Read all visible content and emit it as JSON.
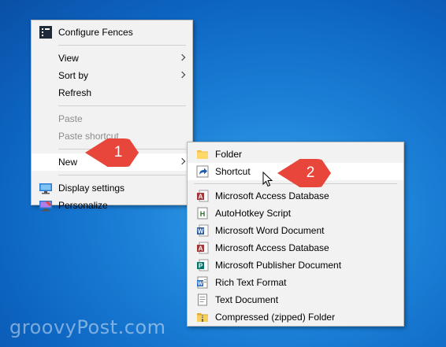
{
  "context_menu": {
    "items": [
      {
        "label": "Configure Fences",
        "icon": "fences-icon",
        "submenu": false,
        "enabled": true
      },
      {
        "label": "View",
        "submenu": true,
        "enabled": true
      },
      {
        "label": "Sort by",
        "submenu": true,
        "enabled": true
      },
      {
        "label": "Refresh",
        "submenu": false,
        "enabled": true
      },
      {
        "label": "Paste",
        "submenu": false,
        "enabled": false
      },
      {
        "label": "Paste shortcut",
        "submenu": false,
        "enabled": false
      },
      {
        "label": "New",
        "submenu": true,
        "enabled": true,
        "highlighted": true
      },
      {
        "label": "Display settings",
        "icon": "display-settings-icon",
        "enabled": true
      },
      {
        "label": "Personalize",
        "icon": "personalize-icon",
        "enabled": true
      }
    ]
  },
  "new_submenu": {
    "items": [
      {
        "label": "Folder",
        "icon": "folder-icon"
      },
      {
        "label": "Shortcut",
        "icon": "shortcut-icon",
        "highlighted": true
      },
      {
        "label": "Microsoft Access Database",
        "icon": "access-icon"
      },
      {
        "label": "AutoHotkey Script",
        "icon": "autohotkey-icon"
      },
      {
        "label": "Microsoft Word Document",
        "icon": "word-icon"
      },
      {
        "label": "Microsoft Access Database",
        "icon": "access-icon"
      },
      {
        "label": "Microsoft Publisher Document",
        "icon": "publisher-icon"
      },
      {
        "label": "Rich Text Format",
        "icon": "wordpad-icon"
      },
      {
        "label": "Text Document",
        "icon": "text-document-icon"
      },
      {
        "label": "Compressed (zipped) Folder",
        "icon": "zip-folder-icon"
      }
    ]
  },
  "callouts": [
    {
      "number": "1"
    },
    {
      "number": "2"
    }
  ],
  "watermark": "groovyPost.com",
  "colors": {
    "callout": "#e8453b",
    "menu_background": "#f2f2f2",
    "desktop": "#1a78d0"
  }
}
